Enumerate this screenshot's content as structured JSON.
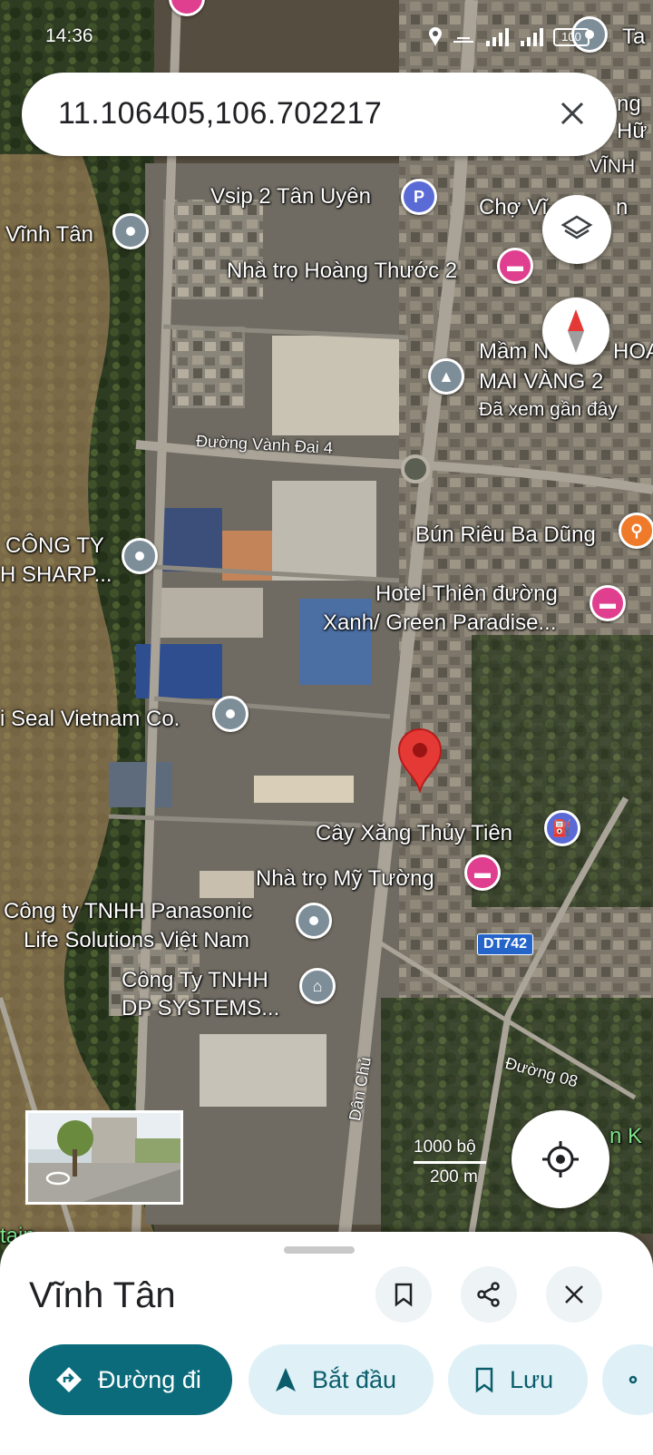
{
  "status": {
    "time": "14:36",
    "battery": "100"
  },
  "search": {
    "query": "11.106405,106.702217"
  },
  "map": {
    "labels": {
      "vsip": "Vsip 2 Tân Uyên",
      "vinh_tan_map": "Vĩnh Tân",
      "cho": "Chợ Vĩ",
      "cho_tail": "n",
      "nha_tro_hoang": "Nhà trọ Hoàng Thước 2",
      "mam_non_1": "Mầm N",
      "mam_non_1b": "HOA",
      "mam_non_2": "MAI VÀNG 2",
      "viewed": "Đã xem gần đây",
      "road_vanh_dai": "Đường Vành Đai 4",
      "bun_rieu": "Bún Riêu Ba Dũng",
      "cong_ty_1": "CÔNG TY",
      "sharp": "H SHARP...",
      "hotel_1": "Hotel Thiên đường",
      "hotel_2": "Xanh/ Green Paradise...",
      "seal": "i Seal Vietnam Co.",
      "cay_xang": "Cây Xăng Thủy Tiên",
      "nha_tro_my": "Nhà trọ Mỹ Tường",
      "panasonic_1": "Công ty TNHH Panasonic",
      "panasonic_2": "Life Solutions Việt Nam",
      "dt742": "DT742",
      "dp_1": "Công Ty TNHH",
      "dp_2": "DP SYSTEMS...",
      "duong_08": "Đường 08",
      "dan_chu": "Dân Chủ",
      "top_right_1": "Ta",
      "top_right_2": "ng",
      "top_right_3": "Hữ",
      "vinh_h": "VĨNH",
      "right_edge": "n K",
      "bottom_left": "tain"
    },
    "scale": {
      "top": "1000 bộ",
      "bottom": "200 m"
    }
  },
  "sheet": {
    "title": "Vĩnh Tân",
    "actions": {
      "directions": "Đường đi",
      "start": "Bắt đầu",
      "save": "Lưu"
    }
  },
  "colors": {
    "primary": "#0b6b7a",
    "pin": "#e53935",
    "pill_bg": "#dff1f7"
  }
}
